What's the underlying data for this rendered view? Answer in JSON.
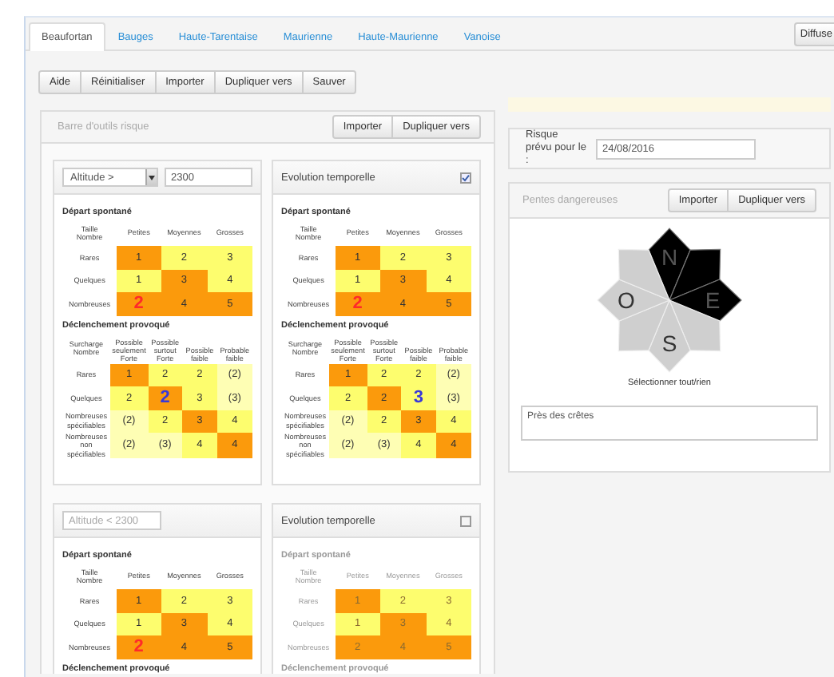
{
  "tabs": [
    {
      "label": "Beaufortan",
      "selected": true
    },
    {
      "label": "Bauges",
      "selected": false
    },
    {
      "label": "Haute-Tarentaise",
      "selected": false
    },
    {
      "label": "Maurienne",
      "selected": false
    },
    {
      "label": "Haute-Maurienne",
      "selected": false
    },
    {
      "label": "Vanoise",
      "selected": false
    }
  ],
  "publish_button": "Diffuse",
  "toolbar": [
    "Aide",
    "Réinitialiser",
    "Importer",
    "Dupliquer vers",
    "Sauver"
  ],
  "risk_panel": {
    "title": "Barre d'outils risque",
    "buttons": [
      "Importer",
      "Dupliquer vers"
    ],
    "cards": [
      {
        "header": {
          "kind": "altitude_select",
          "select": "Altitude >",
          "value": "2300"
        },
        "disabled": false,
        "sections": [
          {
            "title": "Départ spontané",
            "matrix": {
              "kind": "spontaneous",
              "corner": [
                "Taille",
                "Nombre"
              ],
              "columns": [
                "Petites",
                "Moyennes",
                "Grosses"
              ],
              "rows": [
                {
                  "label": "Rares",
                  "cells": [
                    {
                      "text": "1",
                      "color": "#fb9a0c",
                      "selected": false
                    },
                    {
                      "text": "2",
                      "color": "#fdfd6e",
                      "selected": false
                    },
                    {
                      "text": "3",
                      "color": "#fdfd6e",
                      "selected": false
                    }
                  ]
                },
                {
                  "label": "Quelques",
                  "cells": [
                    {
                      "text": "1",
                      "color": "#fdfd6e",
                      "selected": false
                    },
                    {
                      "text": "3",
                      "color": "#fb9a0c",
                      "selected": false
                    },
                    {
                      "text": "4",
                      "color": "#fdfd6e",
                      "selected": false
                    }
                  ]
                },
                {
                  "label": "Nombreuses",
                  "cells": [
                    {
                      "text": "2",
                      "color": "#fb9a0c",
                      "selected": true
                    },
                    {
                      "text": "4",
                      "color": "#fb9a0c",
                      "selected": false
                    },
                    {
                      "text": "5",
                      "color": "#fb9a0c",
                      "selected": false
                    }
                  ]
                }
              ]
            }
          },
          {
            "title": "Déclenchement provoqué",
            "matrix": {
              "kind": "triggered",
              "corner": [
                "Surcharge",
                "Nombre"
              ],
              "columns": [
                "Possible seulement Forte",
                "Possible surtout Forte",
                "Possible faible",
                "Probable faible"
              ],
              "rows": [
                {
                  "label": "Rares",
                  "cells": [
                    {
                      "text": "1",
                      "color": "#fb9a0c",
                      "selected": false
                    },
                    {
                      "text": "2",
                      "color": "#fdfd6e",
                      "selected": false
                    },
                    {
                      "text": "2",
                      "color": "#fdfd6e",
                      "selected": false
                    },
                    {
                      "text": "(2)",
                      "color": "#fefeb4",
                      "selected": false
                    }
                  ]
                },
                {
                  "label": "Quelques",
                  "cells": [
                    {
                      "text": "2",
                      "color": "#fdfd6e",
                      "selected": false
                    },
                    {
                      "text": "2",
                      "color": "#fb9a0c",
                      "selected": true
                    },
                    {
                      "text": "3",
                      "color": "#fdfd6e",
                      "selected": false
                    },
                    {
                      "text": "(3)",
                      "color": "#fefeb4",
                      "selected": false
                    }
                  ]
                },
                {
                  "label": "Nombreuses spécifiables",
                  "cells": [
                    {
                      "text": "(2)",
                      "color": "#fefeb4",
                      "selected": false
                    },
                    {
                      "text": "2",
                      "color": "#fdfd6e",
                      "selected": false
                    },
                    {
                      "text": "3",
                      "color": "#fb9a0c",
                      "selected": false
                    },
                    {
                      "text": "4",
                      "color": "#fdfd6e",
                      "selected": false
                    }
                  ]
                },
                {
                  "label": "Nombreuses non spécifiables",
                  "cells": [
                    {
                      "text": "(2)",
                      "color": "#fefeb4",
                      "selected": false
                    },
                    {
                      "text": "(3)",
                      "color": "#fefeb4",
                      "selected": false
                    },
                    {
                      "text": "4",
                      "color": "#fdfd6e",
                      "selected": false
                    },
                    {
                      "text": "4",
                      "color": "#fb9a0c",
                      "selected": false
                    }
                  ]
                }
              ]
            }
          }
        ]
      },
      {
        "header": {
          "kind": "evolution",
          "label": "Evolution temporelle",
          "checked": true
        },
        "disabled": false,
        "sections": [
          {
            "title": "Départ spontané",
            "matrix": {
              "kind": "spontaneous",
              "corner": [
                "Taille",
                "Nombre"
              ],
              "columns": [
                "Petites",
                "Moyennes",
                "Grosses"
              ],
              "rows": [
                {
                  "label": "Rares",
                  "cells": [
                    {
                      "text": "1",
                      "color": "#fb9a0c",
                      "selected": false
                    },
                    {
                      "text": "2",
                      "color": "#fdfd6e",
                      "selected": false
                    },
                    {
                      "text": "3",
                      "color": "#fdfd6e",
                      "selected": false
                    }
                  ]
                },
                {
                  "label": "Quelques",
                  "cells": [
                    {
                      "text": "1",
                      "color": "#fdfd6e",
                      "selected": false
                    },
                    {
                      "text": "3",
                      "color": "#fb9a0c",
                      "selected": false
                    },
                    {
                      "text": "4",
                      "color": "#fdfd6e",
                      "selected": false
                    }
                  ]
                },
                {
                  "label": "Nombreuses",
                  "cells": [
                    {
                      "text": "2",
                      "color": "#fb9a0c",
                      "selected": true
                    },
                    {
                      "text": "4",
                      "color": "#fb9a0c",
                      "selected": false
                    },
                    {
                      "text": "5",
                      "color": "#fb9a0c",
                      "selected": false
                    }
                  ]
                }
              ]
            }
          },
          {
            "title": "Déclenchement provoqué",
            "matrix": {
              "kind": "triggered",
              "corner": [
                "Surcharge",
                "Nombre"
              ],
              "columns": [
                "Possible seulement Forte",
                "Possible surtout Forte",
                "Possible faible",
                "Probable faible"
              ],
              "rows": [
                {
                  "label": "Rares",
                  "cells": [
                    {
                      "text": "1",
                      "color": "#fb9a0c",
                      "selected": false
                    },
                    {
                      "text": "2",
                      "color": "#fdfd6e",
                      "selected": false
                    },
                    {
                      "text": "2",
                      "color": "#fdfd6e",
                      "selected": false
                    },
                    {
                      "text": "(2)",
                      "color": "#fefeb4",
                      "selected": false
                    }
                  ]
                },
                {
                  "label": "Quelques",
                  "cells": [
                    {
                      "text": "2",
                      "color": "#fdfd6e",
                      "selected": false
                    },
                    {
                      "text": "2",
                      "color": "#fb9a0c",
                      "selected": false
                    },
                    {
                      "text": "3",
                      "color": "#fdfd6e",
                      "selected": true
                    },
                    {
                      "text": "(3)",
                      "color": "#fefeb4",
                      "selected": false
                    }
                  ]
                },
                {
                  "label": "Nombreuses spécifiables",
                  "cells": [
                    {
                      "text": "(2)",
                      "color": "#fefeb4",
                      "selected": false
                    },
                    {
                      "text": "2",
                      "color": "#fdfd6e",
                      "selected": false
                    },
                    {
                      "text": "3",
                      "color": "#fb9a0c",
                      "selected": false
                    },
                    {
                      "text": "4",
                      "color": "#fdfd6e",
                      "selected": false
                    }
                  ]
                },
                {
                  "label": "Nombreuses non spécifiables",
                  "cells": [
                    {
                      "text": "(2)",
                      "color": "#fefeb4",
                      "selected": false
                    },
                    {
                      "text": "(3)",
                      "color": "#fefeb4",
                      "selected": false
                    },
                    {
                      "text": "4",
                      "color": "#fdfd6e",
                      "selected": false
                    },
                    {
                      "text": "4",
                      "color": "#fb9a0c",
                      "selected": false
                    }
                  ]
                }
              ]
            }
          }
        ]
      },
      {
        "header": {
          "kind": "altitude_field",
          "placeholder": "Altitude < 2300"
        },
        "disabled": false,
        "sections": [
          {
            "title": "Départ spontané",
            "matrix": {
              "kind": "spontaneous",
              "corner": [
                "Taille",
                "Nombre"
              ],
              "columns": [
                "Petites",
                "Moyennes",
                "Grosses"
              ],
              "rows": [
                {
                  "label": "Rares",
                  "cells": [
                    {
                      "text": "1",
                      "color": "#fb9a0c",
                      "selected": false
                    },
                    {
                      "text": "2",
                      "color": "#fdfd6e",
                      "selected": false
                    },
                    {
                      "text": "3",
                      "color": "#fdfd6e",
                      "selected": false
                    }
                  ]
                },
                {
                  "label": "Quelques",
                  "cells": [
                    {
                      "text": "1",
                      "color": "#fdfd6e",
                      "selected": false
                    },
                    {
                      "text": "3",
                      "color": "#fb9a0c",
                      "selected": false
                    },
                    {
                      "text": "4",
                      "color": "#fdfd6e",
                      "selected": false
                    }
                  ]
                },
                {
                  "label": "Nombreuses",
                  "cells": [
                    {
                      "text": "2",
                      "color": "#fb9a0c",
                      "selected": true
                    },
                    {
                      "text": "4",
                      "color": "#fb9a0c",
                      "selected": false
                    },
                    {
                      "text": "5",
                      "color": "#fb9a0c",
                      "selected": false
                    }
                  ]
                }
              ]
            }
          },
          {
            "title": "Déclenchement provoqué"
          }
        ]
      },
      {
        "header": {
          "kind": "evolution",
          "label": "Evolution temporelle",
          "checked": false
        },
        "disabled": true,
        "sections": [
          {
            "title": "Départ spontané",
            "matrix": {
              "kind": "spontaneous",
              "corner": [
                "Taille",
                "Nombre"
              ],
              "columns": [
                "Petites",
                "Moyennes",
                "Grosses"
              ],
              "rows": [
                {
                  "label": "Rares",
                  "cells": [
                    {
                      "text": "1",
                      "color": "#fb9a0c",
                      "selected": false
                    },
                    {
                      "text": "2",
                      "color": "#fdfd6e",
                      "selected": false
                    },
                    {
                      "text": "3",
                      "color": "#fdfd6e",
                      "selected": false
                    }
                  ]
                },
                {
                  "label": "Quelques",
                  "cells": [
                    {
                      "text": "1",
                      "color": "#fdfd6e",
                      "selected": false
                    },
                    {
                      "text": "3",
                      "color": "#fb9a0c",
                      "selected": false
                    },
                    {
                      "text": "4",
                      "color": "#fdfd6e",
                      "selected": false
                    }
                  ]
                },
                {
                  "label": "Nombreuses",
                  "cells": [
                    {
                      "text": "2",
                      "color": "#fb9a0c",
                      "selected": false
                    },
                    {
                      "text": "4",
                      "color": "#fb9a0c",
                      "selected": false
                    },
                    {
                      "text": "5",
                      "color": "#fb9a0c",
                      "selected": false
                    }
                  ]
                }
              ]
            }
          },
          {
            "title": "Déclenchement provoqué"
          }
        ]
      }
    ]
  },
  "forecast": {
    "label": "Risque prévu pour le :",
    "value": "24/08/2016"
  },
  "slopes": {
    "title": "Pentes dangereuses",
    "buttons": [
      "Importer",
      "Dupliquer vers"
    ],
    "sectors": [
      {
        "label": "N",
        "selected": true
      },
      {
        "selected": true
      },
      {
        "label": "E",
        "selected": true
      },
      {
        "selected": false
      },
      {
        "label": "S",
        "selected": false
      },
      {
        "selected": false
      },
      {
        "label": "O",
        "selected": false
      },
      {
        "selected": false
      }
    ],
    "select_all": "Sélectionner tout/rien",
    "note": "Près des crêtes"
  }
}
